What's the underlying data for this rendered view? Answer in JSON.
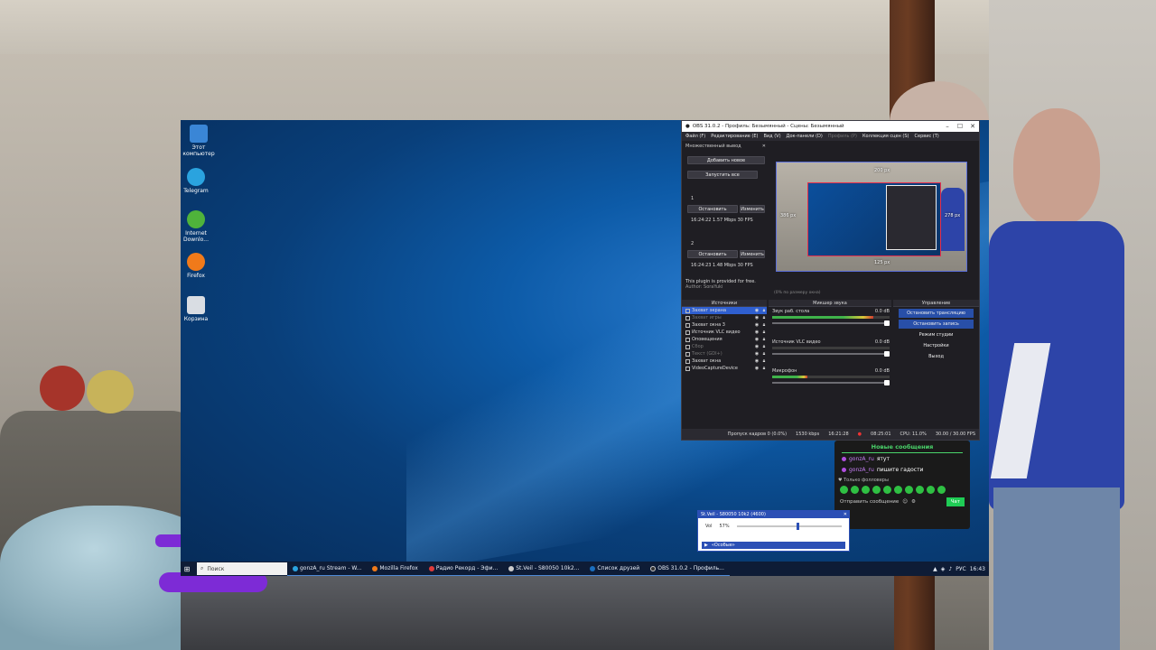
{
  "desktop_icons": [
    {
      "label": "Этот компьютер",
      "color": "#3a86d6"
    },
    {
      "label": "Telegram",
      "color": "#2aa3df"
    },
    {
      "label": "Internet Downlo...",
      "color": "#4fb33b"
    },
    {
      "label": "Firefox",
      "color": "#f07a1a"
    },
    {
      "label": "Корзина",
      "color": "#d9dde3"
    }
  ],
  "taskbar": {
    "search_placeholder": "Поиск",
    "items": [
      {
        "label": "gonzA_ru Stream - W...",
        "color": "#2aa3df"
      },
      {
        "label": "Mozilla Firefox",
        "color": "#f07a1a"
      },
      {
        "label": "Радио Рекорд - Эфи...",
        "color": "#e03b3b"
      },
      {
        "label": "St.Veil - S80050 10k2...",
        "color": "#ccc"
      },
      {
        "label": "Список друзей",
        "color": "#1b6fbf"
      },
      {
        "label": "OBS 31.0.2 - Профиль...",
        "color": "#333"
      }
    ],
    "lang": "РУС",
    "clock": "16:43"
  },
  "obs": {
    "title": "OBS 31.0.2 - Профиль: Безымянный - Сцены: Безымянный",
    "menu": [
      "Файл (F)",
      "Редактирование (E)",
      "Вид (V)",
      "Док-панели (D)",
      "Профиль (P)",
      "Коллекция сцен (S)",
      "Сервис (T)"
    ],
    "multi_output": {
      "title": "Множественный вывод",
      "add_new": "Добавить новое",
      "start_all": "Запустить все",
      "targets": [
        {
          "num": "1",
          "stop": "Остановить",
          "edit": "Изменить",
          "stats": "16:24:22 1.57 Mbps 30 FPS"
        },
        {
          "num": "2",
          "stop": "Остановить",
          "edit": "Изменить",
          "stats": "16:24:23 1.48 Mbps 30 FPS"
        }
      ],
      "plugin_note": "This plugin is provided for free.",
      "author": "Author: SoraYuki"
    },
    "preview": {
      "label_top": "200 px",
      "label_left": "386 px",
      "label_right": "278 px",
      "label_bottom": "125 px",
      "scale": "(0% по размеру окна)"
    },
    "docks": {
      "sources_title": "Источники",
      "mixer_title": "Микшер звука",
      "controls_title": "Управление"
    },
    "sources": [
      {
        "name": "Захват экрана",
        "selected": true,
        "dim": false
      },
      {
        "name": "Захват игры",
        "selected": false,
        "dim": true
      },
      {
        "name": "Захват окна 3",
        "selected": false,
        "dim": false
      },
      {
        "name": "Источник VLC видео",
        "selected": false,
        "dim": false
      },
      {
        "name": "Оповещения",
        "selected": false,
        "dim": false
      },
      {
        "name": "Сбор",
        "selected": false,
        "dim": true
      },
      {
        "name": "Текст (GDI+)",
        "selected": false,
        "dim": true
      },
      {
        "name": "Захват окна",
        "selected": false,
        "dim": false
      },
      {
        "name": "VideoCaptureDevice",
        "selected": false,
        "dim": false
      }
    ],
    "mixer": [
      {
        "name": "Звук раб. стола",
        "db": "0.0 dB",
        "level": 0.86
      },
      {
        "name": "Источник VLC видео",
        "db": "0.0 dB",
        "level": 0.0
      },
      {
        "name": "Микрофон",
        "db": "0.0 dB",
        "level": 0.3
      }
    ],
    "controls": [
      {
        "label": "Остановить трансляцию",
        "active": true
      },
      {
        "label": "Остановить запись",
        "active": true
      },
      {
        "label": "Режим студии",
        "active": false
      },
      {
        "label": "Настройки",
        "active": false
      },
      {
        "label": "Выход",
        "active": false
      }
    ],
    "status": {
      "dropped": "Пропуск кадров 0 (0.0%)",
      "bitrate": "1530 kbps",
      "stream_time": "16:21:28",
      "rec_time": "08:25:01",
      "cpu": "CPU: 11.0%",
      "fps": "30.00 / 30.00 FPS"
    }
  },
  "chat": {
    "header": "Новые сообщения",
    "messages": [
      {
        "user": "gonzA_ru",
        "text": "ятут"
      },
      {
        "user": "gonzA_ru",
        "text": "пишите гадости"
      }
    ],
    "filter": "Только фолловеры",
    "send_placeholder": "Отправить сообщение",
    "send_button": "Чат"
  },
  "volume_popup": {
    "title": "St.Veil - S80050 10k2 (4600)",
    "label": "Vol",
    "value": "57%",
    "level": 0.57,
    "footer": "«Особые»"
  }
}
